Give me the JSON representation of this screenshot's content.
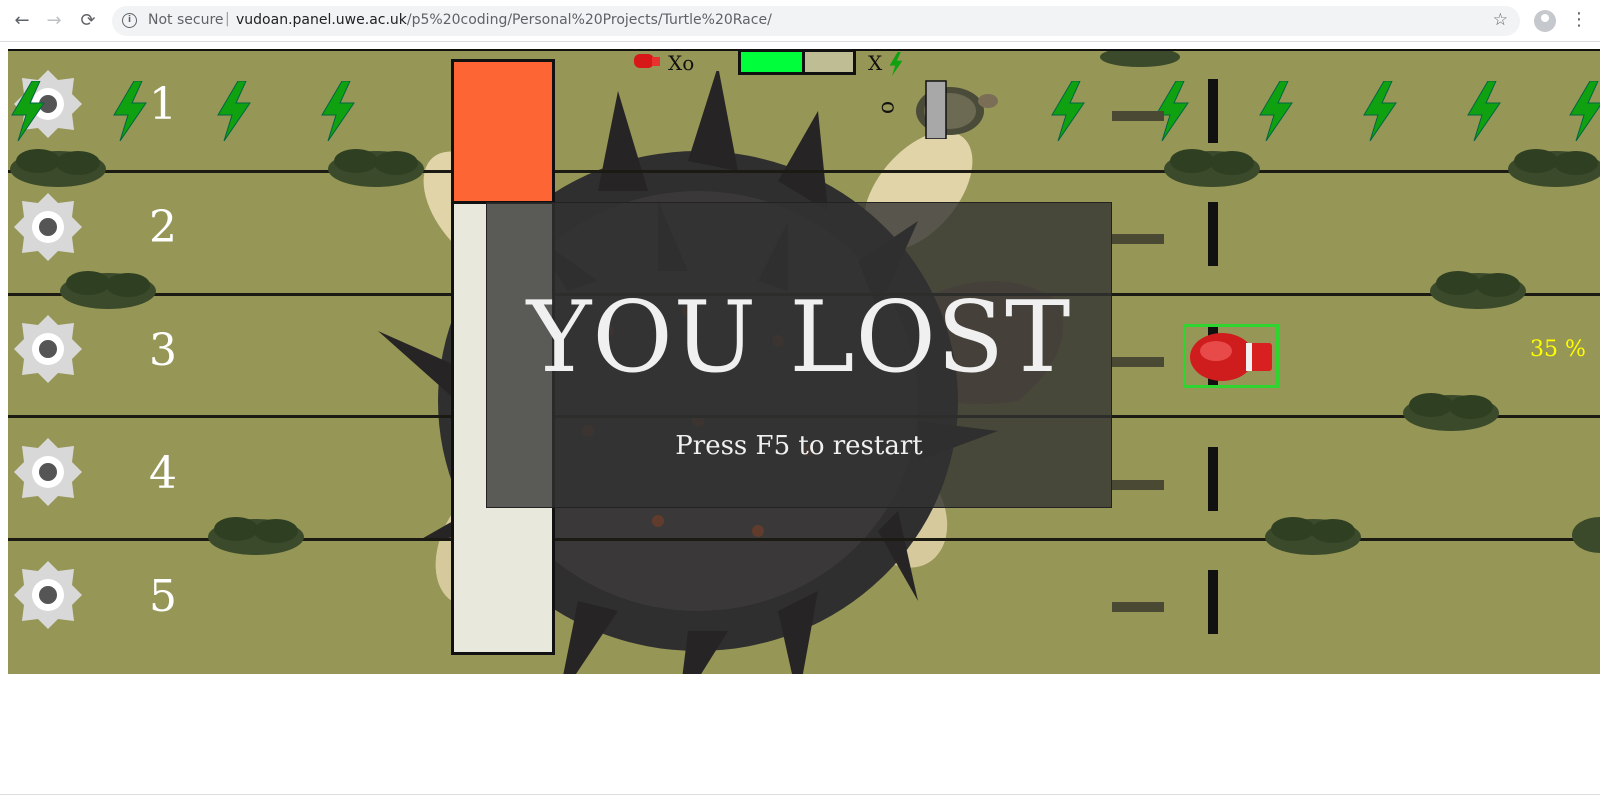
{
  "browser": {
    "security_label": "Not secure",
    "separator": "|",
    "url_host": "vudoan.panel.uwe.ac.uk",
    "url_path": "/p5%20coding/Personal%20Projects/Turtle%20Race/",
    "icons": [
      "back-arrow-icon",
      "forward-arrow-icon",
      "reload-icon",
      "info-icon",
      "star-icon",
      "profile-avatar-icon",
      "menu-dots-icon"
    ]
  },
  "game": {
    "background_color": "#969656",
    "lanes": [
      {
        "number": "1"
      },
      {
        "number": "2"
      },
      {
        "number": "3"
      },
      {
        "number": "4"
      },
      {
        "number": "5"
      }
    ],
    "hud": {
      "glove_count_label": "Xo",
      "bolt_count_label": "X",
      "turtle_label": "o",
      "stamina_fraction": 0.57,
      "power_fraction": 0.24
    },
    "progress_label": "35 %",
    "overlay": {
      "title": "YOU LOST",
      "subtitle": "Press F5 to restart"
    },
    "colors": {
      "power_bar": "#fe6535",
      "stamina_bar": "#00fe3b",
      "bolt": "#0fa10f",
      "progress_text": "#fefe00",
      "glove_box": "#2fd52f"
    }
  }
}
